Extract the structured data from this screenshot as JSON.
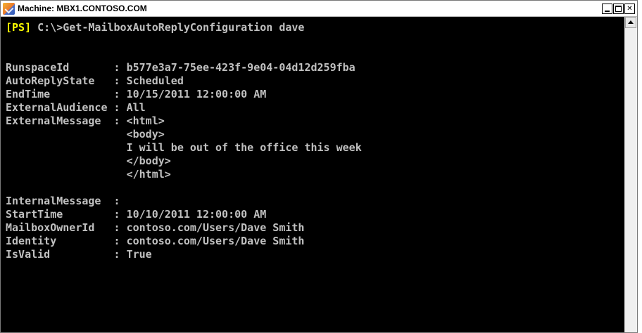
{
  "window": {
    "title": "Machine: MBX1.CONTOSO.COM",
    "minimize_glyph": "",
    "maximize_glyph": "",
    "close_glyph": ""
  },
  "console": {
    "prompt_tag": "[PS]",
    "command": " C:\\>Get-MailboxAutoReplyConfiguration dave",
    "lines": [
      "",
      "",
      "RunspaceId       : b577e3a7-75ee-423f-9e04-04d12d259fba",
      "AutoReplyState   : Scheduled",
      "EndTime          : 10/15/2011 12:00:00 AM",
      "ExternalAudience : All",
      "ExternalMessage  : <html>",
      "                   <body>",
      "                   I will be out of the office this week",
      "                   </body>",
      "                   </html>",
      "",
      "InternalMessage  :",
      "StartTime        : 10/10/2011 12:00:00 AM",
      "MailboxOwnerId   : contoso.com/Users/Dave Smith",
      "Identity         : contoso.com/Users/Dave Smith",
      "IsValid          : True"
    ]
  },
  "colors": {
    "console_background": "#000000",
    "console_text": "#c0c0c0",
    "prompt_tag": "#ffff00"
  }
}
